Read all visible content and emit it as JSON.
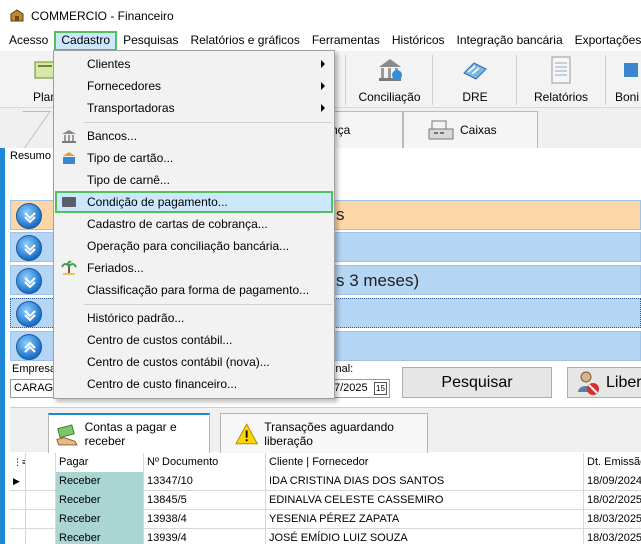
{
  "window": {
    "title": "COMMERCIO - Financeiro"
  },
  "menubar": {
    "items": [
      "Acesso",
      "Cadastro",
      "Pesquisas",
      "Relatórios e gráficos",
      "Ferramentas",
      "Históricos",
      "Integração bancária",
      "Exportações"
    ]
  },
  "toolbar": {
    "items": [
      "Plan",
      "Conciliação",
      "DRE",
      "Relatórios",
      "Boni"
    ]
  },
  "top_tabs": {
    "partial_label": "nça",
    "caixas": "Caixas"
  },
  "resumo_label": "Resumo",
  "accordion": {
    "row1_text": "s",
    "row3_text": "s 3 meses)"
  },
  "filters": {
    "empresa_label": "Empresa",
    "empresa_value": "CARAGU",
    "final_label": "final:",
    "final_value": "7/2025",
    "pesquisar": "Pesquisar",
    "liberar": "Liber"
  },
  "lower_tabs": {
    "tab1": "Contas a pagar e receber",
    "tab2": "Transações aguardando liberação"
  },
  "grid": {
    "headers": [
      "Pagar",
      "Nº Documento",
      "Cliente | Fornecedor",
      "Dt. Emissão"
    ],
    "rows": [
      [
        "Receber",
        "13347/10",
        "IDA CRISTINA DIAS DOS SANTOS",
        "18/09/2024"
      ],
      [
        "Receber",
        "13845/5",
        "EDINALVA CELESTE CASSEMIRO",
        "18/02/2025"
      ],
      [
        "Receber",
        "13938/4",
        "YESENIA PÉREZ ZAPATA",
        "18/03/2025"
      ],
      [
        "Receber",
        "13939/4",
        "JOSÉ EMÍDIO LUIZ SOUZA",
        "18/03/2025"
      ]
    ]
  },
  "dropdown": {
    "items": [
      "Clientes",
      "Fornecedores",
      "Transportadoras",
      "Bancos...",
      "Tipo de cartão...",
      "Tipo de carnê...",
      "Condição de pagamento...",
      "Cadastro de cartas de cobrança...",
      "Operação para conciliação bancária...",
      "Feriados...",
      "Classificação para forma de pagamento...",
      "Histórico padrão...",
      "Centro de custos contábil...",
      "Centro de custos contábil (nova)...",
      "Centro de custo financeiro..."
    ]
  },
  "colors": {
    "accent": "#1e88d6",
    "highlight_border": "#52c15a",
    "teal_cell": "#a9d5d3"
  }
}
